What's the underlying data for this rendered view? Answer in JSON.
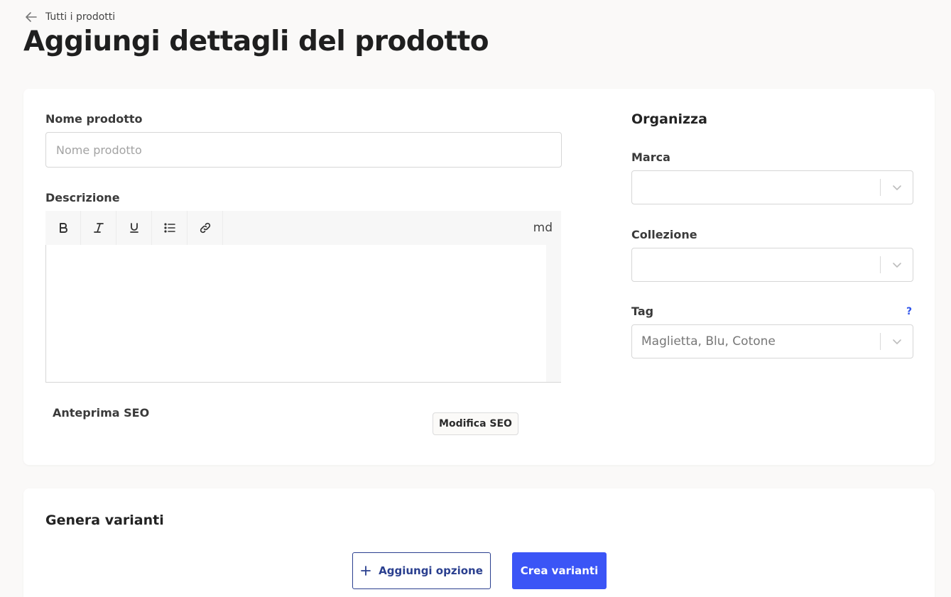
{
  "header": {
    "back_label": "Tutti i prodotti",
    "title": "Aggiungi dettagli del prodotto"
  },
  "product": {
    "name_label": "Nome prodotto",
    "name_placeholder": "Nome prodotto",
    "name_value": "",
    "description_label": "Descrizione",
    "toolbar": {
      "bold_icon": "bold-icon",
      "italic_icon": "italic-icon",
      "underline_icon": "underline-icon",
      "list_icon": "bullet-list-icon",
      "link_icon": "link-icon",
      "mode_label": "md"
    },
    "seo_label": "Anteprima SEO",
    "seo_button": "Modifica SEO"
  },
  "organize": {
    "title": "Organizza",
    "brand_label": "Marca",
    "brand_value": "",
    "collection_label": "Collezione",
    "collection_value": "",
    "tag_label": "Tag",
    "tag_help": "?",
    "tag_placeholder": "Maglietta, Blu, Cotone"
  },
  "variants": {
    "title": "Genera varianti",
    "add_option_label": "Aggiungi opzione",
    "create_label": "Crea varianti"
  },
  "colors": {
    "primary": "#3b55f6",
    "outline_accent": "#2a3f8f",
    "help": "#2f54eb"
  }
}
